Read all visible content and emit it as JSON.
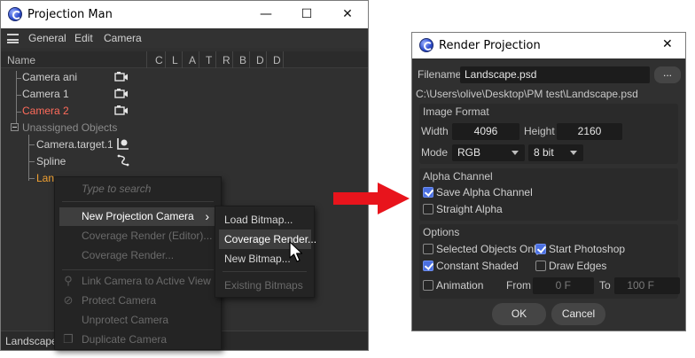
{
  "projection_man": {
    "title": "Projection Man",
    "controls": {
      "minimize": "—",
      "maximize": "☐",
      "close": "✕"
    },
    "menu": [
      "General",
      "Edit",
      "Camera"
    ],
    "header": {
      "name": "Name",
      "columns": [
        "C",
        "L",
        "A",
        "T",
        "R",
        "B",
        "D",
        "D"
      ]
    },
    "tree": [
      {
        "label": "Camera ani",
        "color": "#cfcfcf",
        "icon": "camera-icon"
      },
      {
        "label": "Camera 1",
        "color": "#cfcfcf",
        "icon": "camera-icon"
      },
      {
        "label": "Camera 2",
        "color": "#ff6b5b",
        "icon": "camera-icon"
      },
      {
        "label": "Unassigned Objects",
        "color": "#8c8c8c",
        "icon": "collapse-box-icon"
      },
      {
        "label": "Camera.target.1",
        "color": "#cfcfcf",
        "icon": "target-object-icon"
      },
      {
        "label": "Spline",
        "color": "#cfcfcf",
        "icon": "spline-icon"
      },
      {
        "label": "Lan",
        "color": "#f0a030",
        "icon": ""
      }
    ],
    "status": "Landscape"
  },
  "context_menu": {
    "search_placeholder": "Type to search",
    "items": [
      {
        "label": "New Projection Camera",
        "state": "highlighted",
        "submenu_arrow": "›"
      },
      {
        "label": "Coverage Render (Editor)...",
        "state": "disabled"
      },
      {
        "label": "Coverage Render...",
        "state": "disabled"
      },
      {
        "label": "Link Camera to Active View",
        "state": "disabled",
        "icon": "link-icon"
      },
      {
        "label": "Protect Camera",
        "state": "disabled",
        "icon": "protect-icon"
      },
      {
        "label": "Unprotect Camera",
        "state": "disabled"
      },
      {
        "label": "Duplicate Camera",
        "state": "disabled",
        "icon": "duplicate-icon"
      }
    ],
    "submenu": [
      {
        "label": "Load Bitmap...",
        "state": "normal"
      },
      {
        "label": "Coverage Render...",
        "state": "highlighted"
      },
      {
        "label": "New Bitmap...",
        "state": "normal"
      },
      {
        "label": "Existing Bitmaps",
        "state": "disabled"
      }
    ]
  },
  "arrow_color": "#e8141c",
  "render_projection": {
    "title": "Render Projection",
    "close": "✕",
    "filename_label": "Filename",
    "filename_value": "Landscape.psd",
    "browse_label": "...",
    "path": "C:\\Users\\olive\\Desktop\\PM test\\Landscape.psd",
    "image_format": {
      "heading": "Image Format",
      "width_label": "Width",
      "width_value": "4096",
      "height_label": "Height",
      "height_value": "2160",
      "mode_label": "Mode",
      "mode_value": "RGB",
      "depth_value": "8 bit"
    },
    "alpha": {
      "heading": "Alpha Channel",
      "save_alpha": {
        "label": "Save Alpha Channel",
        "checked": true
      },
      "straight_alpha": {
        "label": "Straight Alpha",
        "checked": false
      }
    },
    "options": {
      "heading": "Options",
      "selected_only": {
        "label": "Selected Objects Only",
        "checked": false
      },
      "start_photoshop": {
        "label": "Start Photoshop",
        "checked": true
      },
      "constant_shaded": {
        "label": "Constant Shaded",
        "checked": true
      },
      "draw_edges": {
        "label": "Draw Edges",
        "checked": false
      },
      "animation": {
        "label": "Animation",
        "checked": false
      },
      "from_label": "From",
      "from_value": "0 F",
      "to_label": "To",
      "to_value": "100 F"
    },
    "ok_label": "OK",
    "cancel_label": "Cancel"
  }
}
